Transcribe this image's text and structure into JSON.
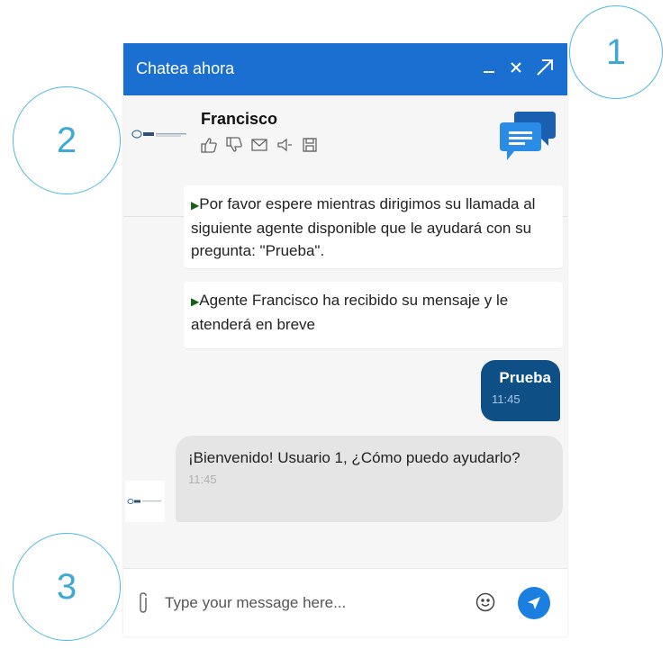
{
  "callouts": [
    "1",
    "2",
    "3"
  ],
  "header": {
    "title": "Chatea ahora"
  },
  "agent": {
    "name": "Francisco"
  },
  "messages": {
    "system_1": "Por favor espere mientras dirigimos su llamada al siguiente agente disponible que le ayudará con su pregunta: \"Prueba\".",
    "system_2": "Agente Francisco ha recibido su mensaje y le atenderá en breve",
    "user": {
      "text": "Prueba",
      "time": "11:45"
    },
    "agent_reply": {
      "text": "¡Bienvenido! Usuario 1, ¿Cómo puedo ayudarlo?",
      "time": "11:45"
    }
  },
  "composer": {
    "placeholder": "Type your message here..."
  },
  "icons": {
    "header": [
      "minimize-icon",
      "close-icon",
      "expand-icon"
    ],
    "actions": [
      "thumbs-up-icon",
      "thumbs-down-icon",
      "email-icon",
      "speaker-icon",
      "save-icon"
    ],
    "composer": [
      "paperclip-icon",
      "emoji-icon",
      "send-icon"
    ]
  },
  "colors": {
    "header_bg": "#1a6fd0",
    "user_bubble": "#0e4f86",
    "agent_bubble": "#e5e5e5",
    "send_button": "#1a7fe0",
    "callout_border": "#4fb8df"
  }
}
